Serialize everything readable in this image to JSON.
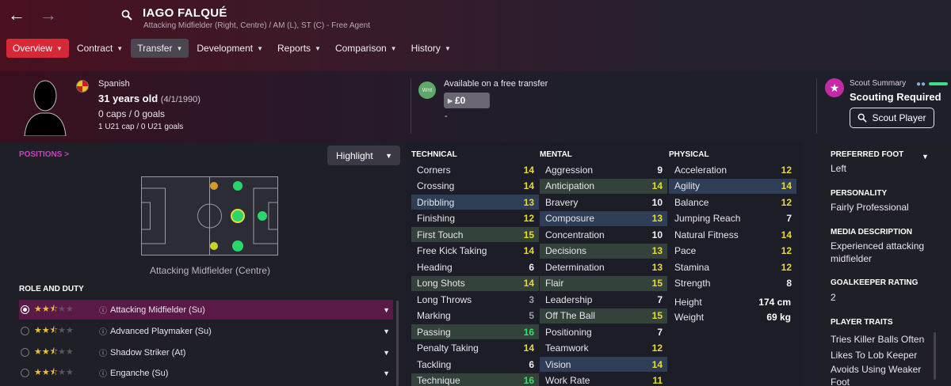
{
  "header": {
    "player_name": "IAGO FALQUÉ",
    "subtitle": "Attacking Midfielder (Right, Centre) / AM (L), ST (C) - Free Agent"
  },
  "tabs": [
    {
      "label": "Overview"
    },
    {
      "label": "Contract"
    },
    {
      "label": "Transfer"
    },
    {
      "label": "Development"
    },
    {
      "label": "Reports"
    },
    {
      "label": "Comparison"
    },
    {
      "label": "History"
    }
  ],
  "bio": {
    "nationality": "Spanish",
    "age": "31 years old",
    "dob": "(4/1/1990)",
    "caps": "0 caps / 0 goals",
    "u21": "1 U21 cap / 0 U21 goals"
  },
  "transfer": {
    "badge": "Wnt",
    "status": "Available on a free transfer",
    "price": "£0",
    "extra": "-"
  },
  "scout": {
    "label": "Scout Summary",
    "value": "Scouting Required",
    "button": "Scout Player"
  },
  "positions": {
    "title": "POSITIONS >",
    "highlight_label": "Highlight",
    "caption": "Attacking Midfielder (Centre)"
  },
  "roles": {
    "title": "ROLE AND DUTY",
    "items": [
      {
        "label": "Attacking Midfielder (Su)",
        "stars": 2.5,
        "selected": true
      },
      {
        "label": "Advanced Playmaker (Su)",
        "stars": 2.5,
        "selected": false
      },
      {
        "label": "Shadow Striker (At)",
        "stars": 2.5,
        "selected": false
      },
      {
        "label": "Enganche (Su)",
        "stars": 2.5,
        "selected": false
      }
    ]
  },
  "attributes": {
    "technical_title": "TECHNICAL",
    "mental_title": "MENTAL",
    "physical_title": "PHYSICAL",
    "technical": [
      {
        "name": "Corners",
        "value": "14",
        "hl": "",
        "color": "c-yellow"
      },
      {
        "name": "Crossing",
        "value": "14",
        "hl": "",
        "color": "c-yellow"
      },
      {
        "name": "Dribbling",
        "value": "13",
        "hl": "hl-blue",
        "color": "c-yellow"
      },
      {
        "name": "Finishing",
        "value": "12",
        "hl": "",
        "color": "c-yellow"
      },
      {
        "name": "First Touch",
        "value": "15",
        "hl": "hl-green",
        "color": "c-yellow"
      },
      {
        "name": "Free Kick Taking",
        "value": "14",
        "hl": "",
        "color": "c-yellow"
      },
      {
        "name": "Heading",
        "value": "6",
        "hl": "",
        "color": "c-white"
      },
      {
        "name": "Long Shots",
        "value": "14",
        "hl": "hl-green",
        "color": "c-yellow"
      },
      {
        "name": "Long Throws",
        "value": "3",
        "hl": "",
        "color": "c-grey"
      },
      {
        "name": "Marking",
        "value": "5",
        "hl": "",
        "color": "c-grey"
      },
      {
        "name": "Passing",
        "value": "16",
        "hl": "hl-green",
        "color": "c-green"
      },
      {
        "name": "Penalty Taking",
        "value": "14",
        "hl": "",
        "color": "c-yellow"
      },
      {
        "name": "Tackling",
        "value": "6",
        "hl": "",
        "color": "c-white"
      },
      {
        "name": "Technique",
        "value": "16",
        "hl": "hl-green",
        "color": "c-green"
      }
    ],
    "mental": [
      {
        "name": "Aggression",
        "value": "9",
        "hl": "",
        "color": "c-white"
      },
      {
        "name": "Anticipation",
        "value": "14",
        "hl": "hl-green",
        "color": "c-yellow"
      },
      {
        "name": "Bravery",
        "value": "10",
        "hl": "",
        "color": "c-white"
      },
      {
        "name": "Composure",
        "value": "13",
        "hl": "hl-blue",
        "color": "c-yellow"
      },
      {
        "name": "Concentration",
        "value": "10",
        "hl": "",
        "color": "c-white"
      },
      {
        "name": "Decisions",
        "value": "13",
        "hl": "hl-green",
        "color": "c-yellow"
      },
      {
        "name": "Determination",
        "value": "13",
        "hl": "",
        "color": "c-yellow"
      },
      {
        "name": "Flair",
        "value": "15",
        "hl": "hl-green",
        "color": "c-yellow"
      },
      {
        "name": "Leadership",
        "value": "7",
        "hl": "",
        "color": "c-white"
      },
      {
        "name": "Off The Ball",
        "value": "15",
        "hl": "hl-green",
        "color": "c-yellow"
      },
      {
        "name": "Positioning",
        "value": "7",
        "hl": "",
        "color": "c-white"
      },
      {
        "name": "Teamwork",
        "value": "12",
        "hl": "",
        "color": "c-yellow"
      },
      {
        "name": "Vision",
        "value": "14",
        "hl": "hl-blue",
        "color": "c-yellow"
      },
      {
        "name": "Work Rate",
        "value": "11",
        "hl": "",
        "color": "c-yellow"
      }
    ],
    "physical": [
      {
        "name": "Acceleration",
        "value": "12",
        "hl": "",
        "color": "c-yellow"
      },
      {
        "name": "Agility",
        "value": "14",
        "hl": "hl-blue",
        "color": "c-yellow"
      },
      {
        "name": "Balance",
        "value": "12",
        "hl": "",
        "color": "c-yellow"
      },
      {
        "name": "Jumping Reach",
        "value": "7",
        "hl": "",
        "color": "c-white"
      },
      {
        "name": "Natural Fitness",
        "value": "14",
        "hl": "",
        "color": "c-yellow"
      },
      {
        "name": "Pace",
        "value": "12",
        "hl": "",
        "color": "c-yellow"
      },
      {
        "name": "Stamina",
        "value": "12",
        "hl": "",
        "color": "c-yellow"
      },
      {
        "name": "Strength",
        "value": "8",
        "hl": "",
        "color": "c-white"
      }
    ],
    "height_label": "Height",
    "height": "174 cm",
    "weight_label": "Weight",
    "weight": "69 kg"
  },
  "info": {
    "foot_title": "PREFERRED FOOT",
    "foot": "Left",
    "personality_title": "PERSONALITY",
    "personality": "Fairly Professional",
    "media_title": "MEDIA DESCRIPTION",
    "media": "Experienced attacking midfielder",
    "gk_title": "GOALKEEPER RATING",
    "gk": "2",
    "traits_title": "PLAYER TRAITS",
    "traits": [
      "Tries Killer Balls Often",
      "Likes To Lob Keeper",
      "Avoids Using Weaker Foot"
    ]
  },
  "colors": {
    "accent_red": "#d62836",
    "scout_magenta": "#c32aa8",
    "attr_green": "#3fdc6a",
    "attr_yellow": "#e8d83a"
  }
}
